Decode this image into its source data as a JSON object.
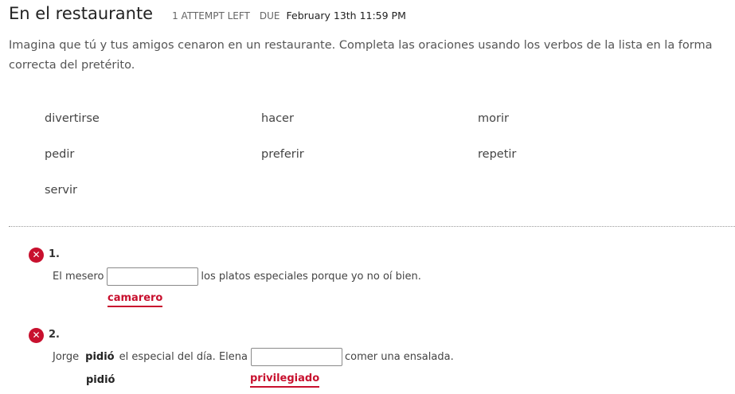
{
  "header": {
    "title": "En el restaurante",
    "attempts": "1 ATTEMPT LEFT",
    "due_label": "DUE",
    "due_date": "February 13th 11:59 PM"
  },
  "instructions": "Imagina que tú y tus amigos cenaron en un restaurante. Completa las oraciones usando los verbos de la lista en la forma correcta del pretérito.",
  "word_bank": [
    "divertirse",
    "hacer",
    "morir",
    "pedir",
    "preferir",
    "repetir",
    "servir"
  ],
  "questions": [
    {
      "number": "1.",
      "status_icon": "error-x-icon",
      "before": "El mesero",
      "after": "los platos especiales porque yo no oí bien.",
      "submitted": "camarero"
    },
    {
      "number": "2.",
      "status_icon": "error-x-icon",
      "prefix": "Jorge",
      "filled": "pidió",
      "middle": "el especial del día. Elena",
      "after": "comer una ensalada.",
      "correct_answer": "pidió",
      "submitted": "privilegiado"
    }
  ],
  "colors": {
    "error": "#c8102e",
    "text": "#333333"
  }
}
